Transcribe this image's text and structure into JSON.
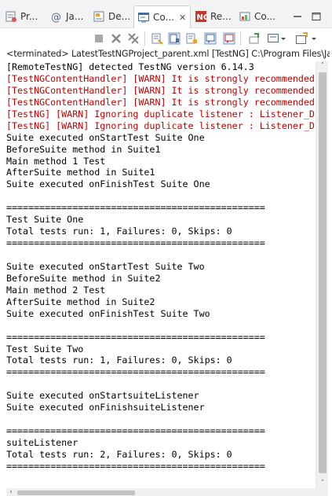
{
  "tabs": [
    {
      "label": "Pr...",
      "icon": "problems-icon"
    },
    {
      "label": "Ja...",
      "icon": "javadoc-icon"
    },
    {
      "label": "De...",
      "icon": "declaration-icon"
    },
    {
      "label": "Co...",
      "icon": "console-icon",
      "active": true
    },
    {
      "label": "Re...",
      "icon": "results-icon"
    },
    {
      "label": "Co...",
      "icon": "coverage-icon"
    }
  ],
  "console": {
    "status": "<terminated> LatestTestNGProject_parent.xml [TestNG] C:\\Program Files\\Java",
    "lines": [
      "[RemoteTestNG] detected TestNG version 6.14.3",
      "[TestNGContentHandler] [WARN] It is strongly recommended",
      "[TestNGContentHandler] [WARN] It is strongly recommended",
      "[TestNGContentHandler] [WARN] It is strongly recommended",
      "[TestNG] [WARN] Ignoring duplicate listener : Listener_D",
      "[TestNG] [WARN] Ignoring duplicate listener : Listener_D",
      "Suite executed onStartTest Suite One",
      "BeforeSuite method in Suite1",
      "Main method 1 Test",
      "AfterSuite method in Suite1",
      "Suite executed onFinishTest Suite One",
      "",
      "===============================================",
      "Test Suite One",
      "Total tests run: 1, Failures: 0, Skips: 0",
      "===============================================",
      "",
      "Suite executed onStartTest Suite Two",
      "BeforeSuite method in Suite2",
      "Main method 2 Test",
      "AfterSuite method in Suite2",
      "Suite executed onFinishTest Suite Two",
      "",
      "===============================================",
      "Test Suite Two",
      "Total tests run: 1, Failures: 0, Skips: 0",
      "===============================================",
      "",
      "Suite executed onStartsuiteListener",
      "Suite executed onFinishsuiteListener",
      "",
      "===============================================",
      "suiteListener",
      "Total tests run: 2, Failures: 0, Skips: 0",
      "==============================================="
    ]
  },
  "colors": {
    "warn_text": "#c00000",
    "normal_text": "#000000",
    "tab_active_bg": "#ffffff",
    "tabbar_bg": "#f3f3f3"
  }
}
